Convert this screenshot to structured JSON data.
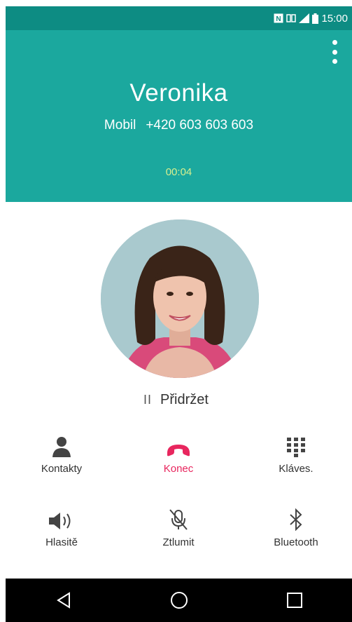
{
  "status_bar": {
    "time": "15:00",
    "icons": [
      "nfc-icon",
      "dual-sim-icon",
      "signal-icon",
      "battery-icon"
    ]
  },
  "call": {
    "name": "Veronika",
    "number_type": "Mobil",
    "number": "+420 603 603 603",
    "duration": "00:04"
  },
  "hold": {
    "label": "Přidržet"
  },
  "actions": [
    {
      "label": "Kontakty",
      "icon": "contacts-icon"
    },
    {
      "label": "Konec",
      "icon": "end-call-icon"
    },
    {
      "label": "Kláves.",
      "icon": "keypad-icon"
    },
    {
      "label": "Hlasitě",
      "icon": "speaker-icon"
    },
    {
      "label": "Ztlumit",
      "icon": "mute-icon"
    },
    {
      "label": "Bluetooth",
      "icon": "bluetooth-icon"
    }
  ],
  "colors": {
    "header": "#1ba89e",
    "status_bar": "#0d8c83",
    "end_call": "#e8265e",
    "timer": "#d6ef8f"
  }
}
